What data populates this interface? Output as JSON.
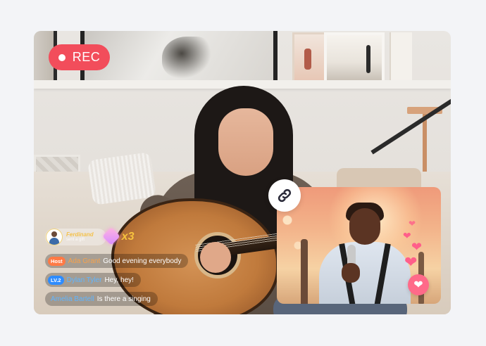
{
  "recording": {
    "label": "REC"
  },
  "gift": {
    "sender": "Ferdinand",
    "sender_sub": "sent a gift",
    "count": "x3"
  },
  "chat": [
    {
      "badge": "Host",
      "badge_type": "host",
      "user": "Ada Grant",
      "user_color": "#f7a24b",
      "message": "Good evening everybody"
    },
    {
      "badge": "LV.2",
      "badge_type": "level",
      "user": "Dylan Tyler",
      "user_color": "#5fb5ff",
      "message": "Hey, hey!"
    },
    {
      "badge": "",
      "badge_type": "none",
      "user": "Amelia Bartell",
      "user_color": "#5fb5ff",
      "message": "Is there a singing"
    }
  ],
  "icons": {
    "link": "link-icon",
    "like": "heart-icon",
    "floating": "heart-icon"
  },
  "colors": {
    "rec": "#f24d5b",
    "host_badge": "#ff7a45",
    "level_badge": "#2e8cff",
    "like_button": "#ff6a89"
  }
}
